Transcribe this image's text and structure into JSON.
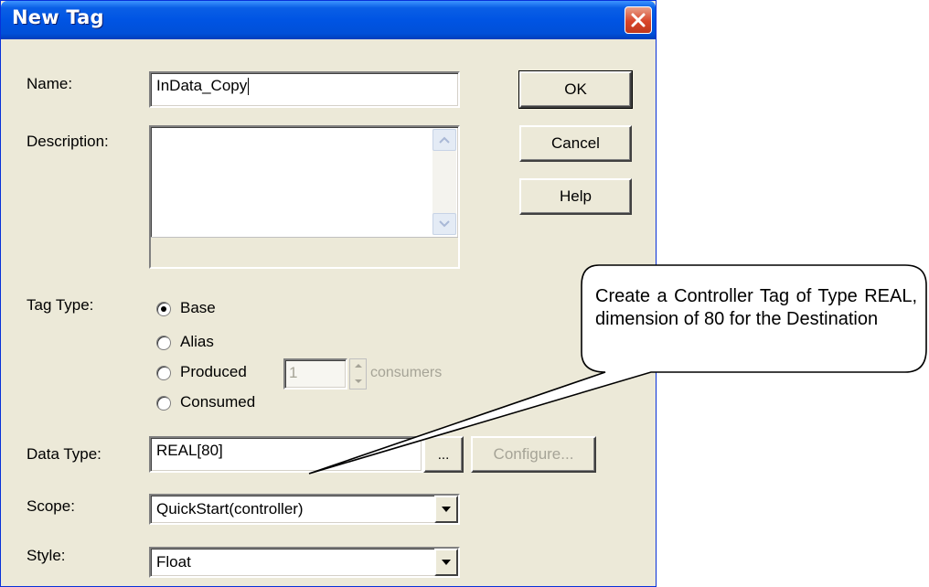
{
  "window": {
    "title": "New Tag"
  },
  "name": {
    "label": "Name:",
    "value": "InData_Copy"
  },
  "description": {
    "label": "Description:",
    "value": ""
  },
  "buttons": {
    "ok": "OK",
    "cancel": "Cancel",
    "help": "Help"
  },
  "tag_type": {
    "label": "Tag Type:",
    "options": [
      "Base",
      "Alias",
      "Produced",
      "Consumed"
    ],
    "selected": "Base",
    "consumers_value": "1",
    "consumers_label": "consumers"
  },
  "data_type": {
    "label": "Data Type:",
    "value": "REAL[80]",
    "browse": "...",
    "configure": "Configure..."
  },
  "scope": {
    "label": "Scope:",
    "value": "QuickStart(controller)"
  },
  "style": {
    "label": "Style:",
    "value": "Float"
  },
  "callout": {
    "text": "Create a Controller Tag of Type REAL, dimension of 80 for the Destination"
  },
  "icons": {
    "close": "close-icon",
    "dropdown": "chevron-down-icon",
    "scroll_up": "scroll-up-icon",
    "scroll_down": "scroll-down-icon"
  }
}
